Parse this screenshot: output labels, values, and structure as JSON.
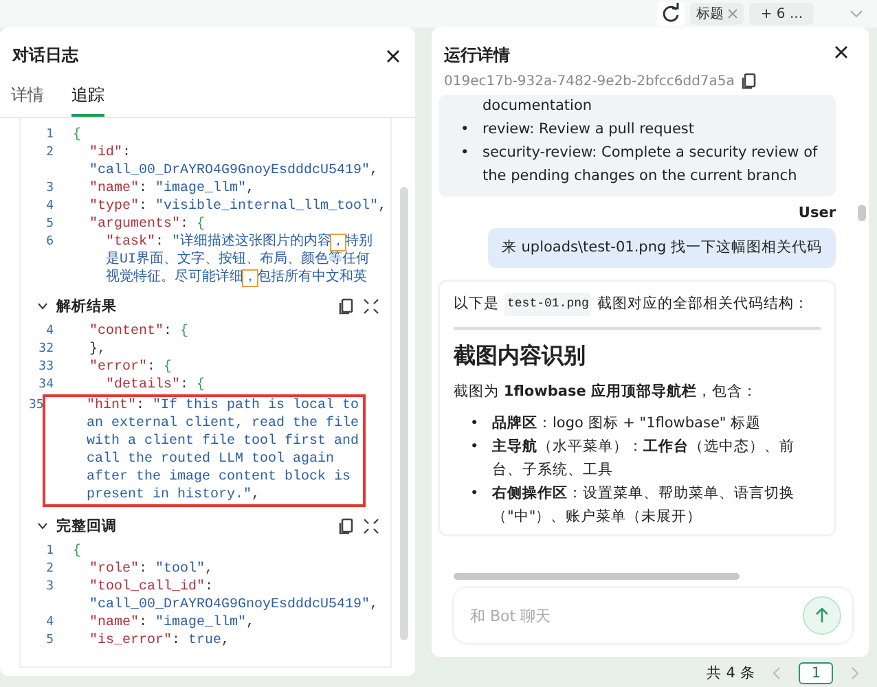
{
  "top_bar": {
    "tags": [
      {
        "kind": "tag",
        "label": "标题",
        "closable": true
      },
      {
        "kind": "more",
        "label": "+ 6 ..."
      }
    ]
  },
  "log_panel": {
    "title": "对话日志",
    "tabs": [
      {
        "label": "详情",
        "selected": false
      },
      {
        "label": "追踪",
        "selected": true
      }
    ],
    "blocks": [
      {
        "rows": [
          {
            "no": "1",
            "parts": [
              {
                "kind": "brace",
                "text": "{"
              }
            ]
          },
          {
            "no": "2",
            "parts": [
              {
                "kind": "key",
                "text": "  \"id\""
              },
              {
                "kind": "punct",
                "text": ":"
              }
            ]
          },
          {
            "parts": [
              {
                "kind": "str",
                "text": "  \"call_00_DrAYRO4G9GnoyEsdddcU5419\""
              },
              {
                "kind": "punct",
                "text": ","
              }
            ]
          },
          {
            "no": "3",
            "parts": [
              {
                "kind": "key",
                "text": "  \"name\""
              },
              {
                "kind": "punct",
                "text": ": "
              },
              {
                "kind": "str",
                "text": "\"image_llm\""
              },
              {
                "kind": "punct",
                "text": ","
              }
            ]
          },
          {
            "no": "4",
            "parts": [
              {
                "kind": "key",
                "text": "  \"type\""
              },
              {
                "kind": "punct",
                "text": ": "
              },
              {
                "kind": "str",
                "text": "\"visible_internal_llm_tool\""
              },
              {
                "kind": "punct",
                "text": ","
              }
            ]
          },
          {
            "no": "5",
            "parts": [
              {
                "kind": "key",
                "text": "  \"arguments\""
              },
              {
                "kind": "punct",
                "text": ": "
              },
              {
                "kind": "brace",
                "text": "{"
              }
            ]
          },
          {
            "no": "6",
            "parts": [
              {
                "kind": "key",
                "text": "    \"task\""
              },
              {
                "kind": "punct",
                "text": ": "
              },
              {
                "kind": "str",
                "text": "\"详细描述这张图片的内容"
              },
              {
                "kind": "match",
                "text": "，"
              },
              {
                "kind": "str",
                "text": "特别"
              }
            ]
          },
          {
            "parts": [
              {
                "kind": "str",
                "text": "    是UI界面、文字、按钮、布局、颜色等任何"
              }
            ]
          },
          {
            "parts": [
              {
                "kind": "str",
                "text": "    视觉特征。尽可能详细"
              },
              {
                "kind": "match",
                "text": "，"
              },
              {
                "kind": "str",
                "text": "包括所有中文和英"
              }
            ]
          }
        ]
      },
      {
        "title": "解析结果",
        "rows": [
          {
            "no": "4",
            "parts": [
              {
                "kind": "key",
                "text": "  \"content\""
              },
              {
                "kind": "punct",
                "text": ": "
              },
              {
                "kind": "brace",
                "text": "{"
              }
            ]
          },
          {
            "no": "32",
            "parts": [
              {
                "kind": "punct",
                "text": "  },"
              }
            ]
          },
          {
            "no": "33",
            "parts": [
              {
                "kind": "key",
                "text": "  \"error\""
              },
              {
                "kind": "punct",
                "text": ": "
              },
              {
                "kind": "brace",
                "text": "{"
              }
            ]
          },
          {
            "no": "34",
            "parts": [
              {
                "kind": "key",
                "text": "    \"details\""
              },
              {
                "kind": "punct",
                "text": ": "
              },
              {
                "kind": "brace",
                "text": "{"
              }
            ]
          },
          {
            "no": "35",
            "boxed": true,
            "parts": [
              {
                "kind": "key",
                "text": "      \"hint\""
              },
              {
                "kind": "punct",
                "text": ": "
              },
              {
                "kind": "str",
                "text": "\"If this path is local to"
              }
            ]
          },
          {
            "boxed": true,
            "parts": [
              {
                "kind": "str",
                "text": "      an external client, read the file"
              }
            ]
          },
          {
            "boxed": true,
            "parts": [
              {
                "kind": "str",
                "text": "      with a client file tool first and"
              }
            ]
          },
          {
            "boxed": true,
            "parts": [
              {
                "kind": "str",
                "text": "      call the routed LLM tool again"
              }
            ]
          },
          {
            "boxed": true,
            "parts": [
              {
                "kind": "str",
                "text": "      after the image content block is"
              }
            ]
          },
          {
            "boxed": true,
            "parts": [
              {
                "kind": "str",
                "text": "      present in history.\""
              },
              {
                "kind": "punct",
                "text": ","
              }
            ]
          }
        ]
      },
      {
        "title": "完整回调",
        "rows": [
          {
            "no": "1",
            "parts": [
              {
                "kind": "brace",
                "text": "{"
              }
            ]
          },
          {
            "no": "2",
            "parts": [
              {
                "kind": "key",
                "text": "  \"role\""
              },
              {
                "kind": "punct",
                "text": ": "
              },
              {
                "kind": "str",
                "text": "\"tool\""
              },
              {
                "kind": "punct",
                "text": ","
              }
            ]
          },
          {
            "no": "3",
            "parts": [
              {
                "kind": "key",
                "text": "  \"tool_call_id\""
              },
              {
                "kind": "punct",
                "text": ":"
              }
            ]
          },
          {
            "parts": [
              {
                "kind": "str",
                "text": "  \"call_00_DrAYRO4G9GnoyEsdddcU5419\""
              },
              {
                "kind": "punct",
                "text": ","
              }
            ]
          },
          {
            "no": "4",
            "parts": [
              {
                "kind": "key",
                "text": "  \"name\""
              },
              {
                "kind": "punct",
                "text": ": "
              },
              {
                "kind": "str",
                "text": "\"image_llm\""
              },
              {
                "kind": "punct",
                "text": ","
              }
            ]
          },
          {
            "no": "5",
            "parts": [
              {
                "kind": "key",
                "text": "  \"is_error\""
              },
              {
                "kind": "punct",
                "text": ": "
              },
              {
                "kind": "str",
                "text": "true"
              },
              {
                "kind": "punct",
                "text": ","
              }
            ]
          }
        ]
      }
    ]
  },
  "run_panel": {
    "title": "运行详情",
    "run_id": "019ec17b-932a-7482-9e2b-2bfcc6dd7a5a",
    "messages": [
      {
        "kind": "bot",
        "continued_text": "documentation",
        "items": [
          {
            "marker": "•",
            "text": "review: Review a pull request"
          },
          {
            "marker": "•",
            "text": "security-review: Complete a security review of the pending changes on the current branch"
          }
        ]
      },
      {
        "kind": "user",
        "author": "User",
        "text": "来 uploads\\test-01.png 找一下这幅图相关代码"
      },
      {
        "kind": "answer",
        "intro": [
          {
            "kind": "text",
            "text": "以下是"
          },
          {
            "kind": "code",
            "text": "test-01.png"
          },
          {
            "kind": "text",
            "text": "截图对应的全部相关代码结构："
          }
        ],
        "heading": "截图内容识别",
        "paragraph": "截图为 **1flowbase 应用顶部导航栏**，包含：",
        "items": [
          {
            "marker": "•",
            "text": "**品牌区**：logo 图标 + \"1flowbase\" 标题"
          },
          {
            "marker": "•",
            "text": "**主导航**（水平菜单）：**工作台**（选中态）、前台、子系统、工具"
          },
          {
            "marker": "•",
            "text": "**右侧操作区**：设置菜单、帮助菜单、语言切换（\"中\"）、账户菜单（未展开）"
          }
        ]
      }
    ],
    "input": {
      "placeholder": "和 Bot 聊天"
    }
  },
  "pagination": {
    "total": "共 4 条",
    "pages": [
      {
        "label": "1",
        "selected": true
      }
    ]
  }
}
